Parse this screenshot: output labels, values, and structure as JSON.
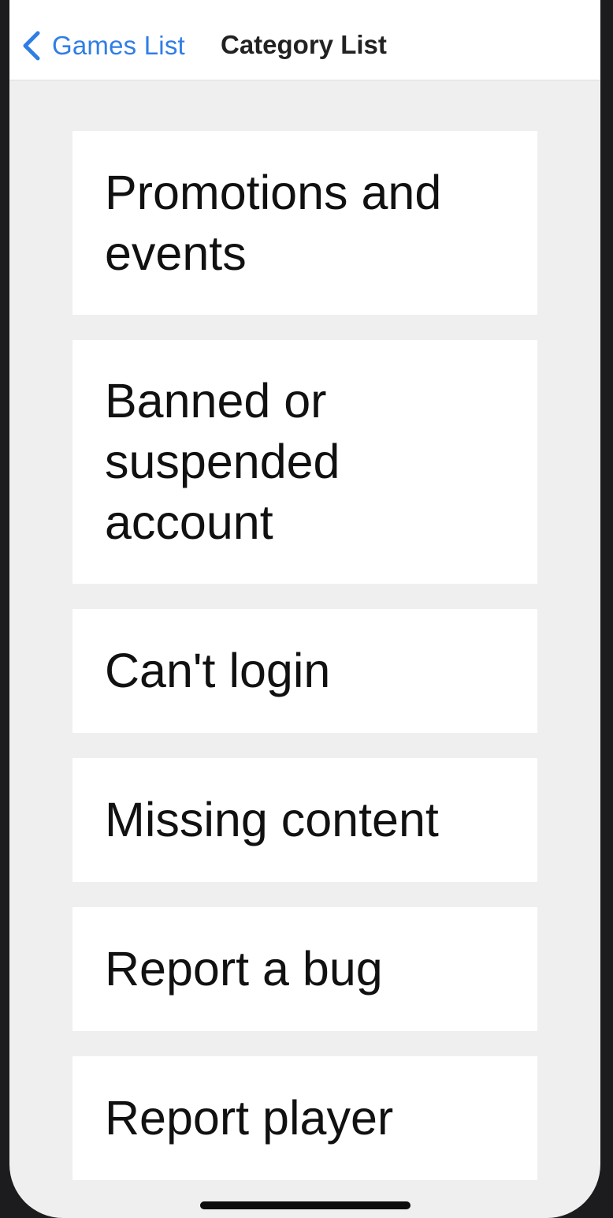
{
  "nav": {
    "back_label": "Games List",
    "back_icon": "chevron-left-icon",
    "title": "Category List",
    "accent_color": "#2f7ee6"
  },
  "categories": [
    {
      "label": "Promotions and events"
    },
    {
      "label": "Banned or suspended account"
    },
    {
      "label": "Can't login"
    },
    {
      "label": "Missing content"
    },
    {
      "label": "Report a bug"
    },
    {
      "label": "Report player"
    }
  ]
}
